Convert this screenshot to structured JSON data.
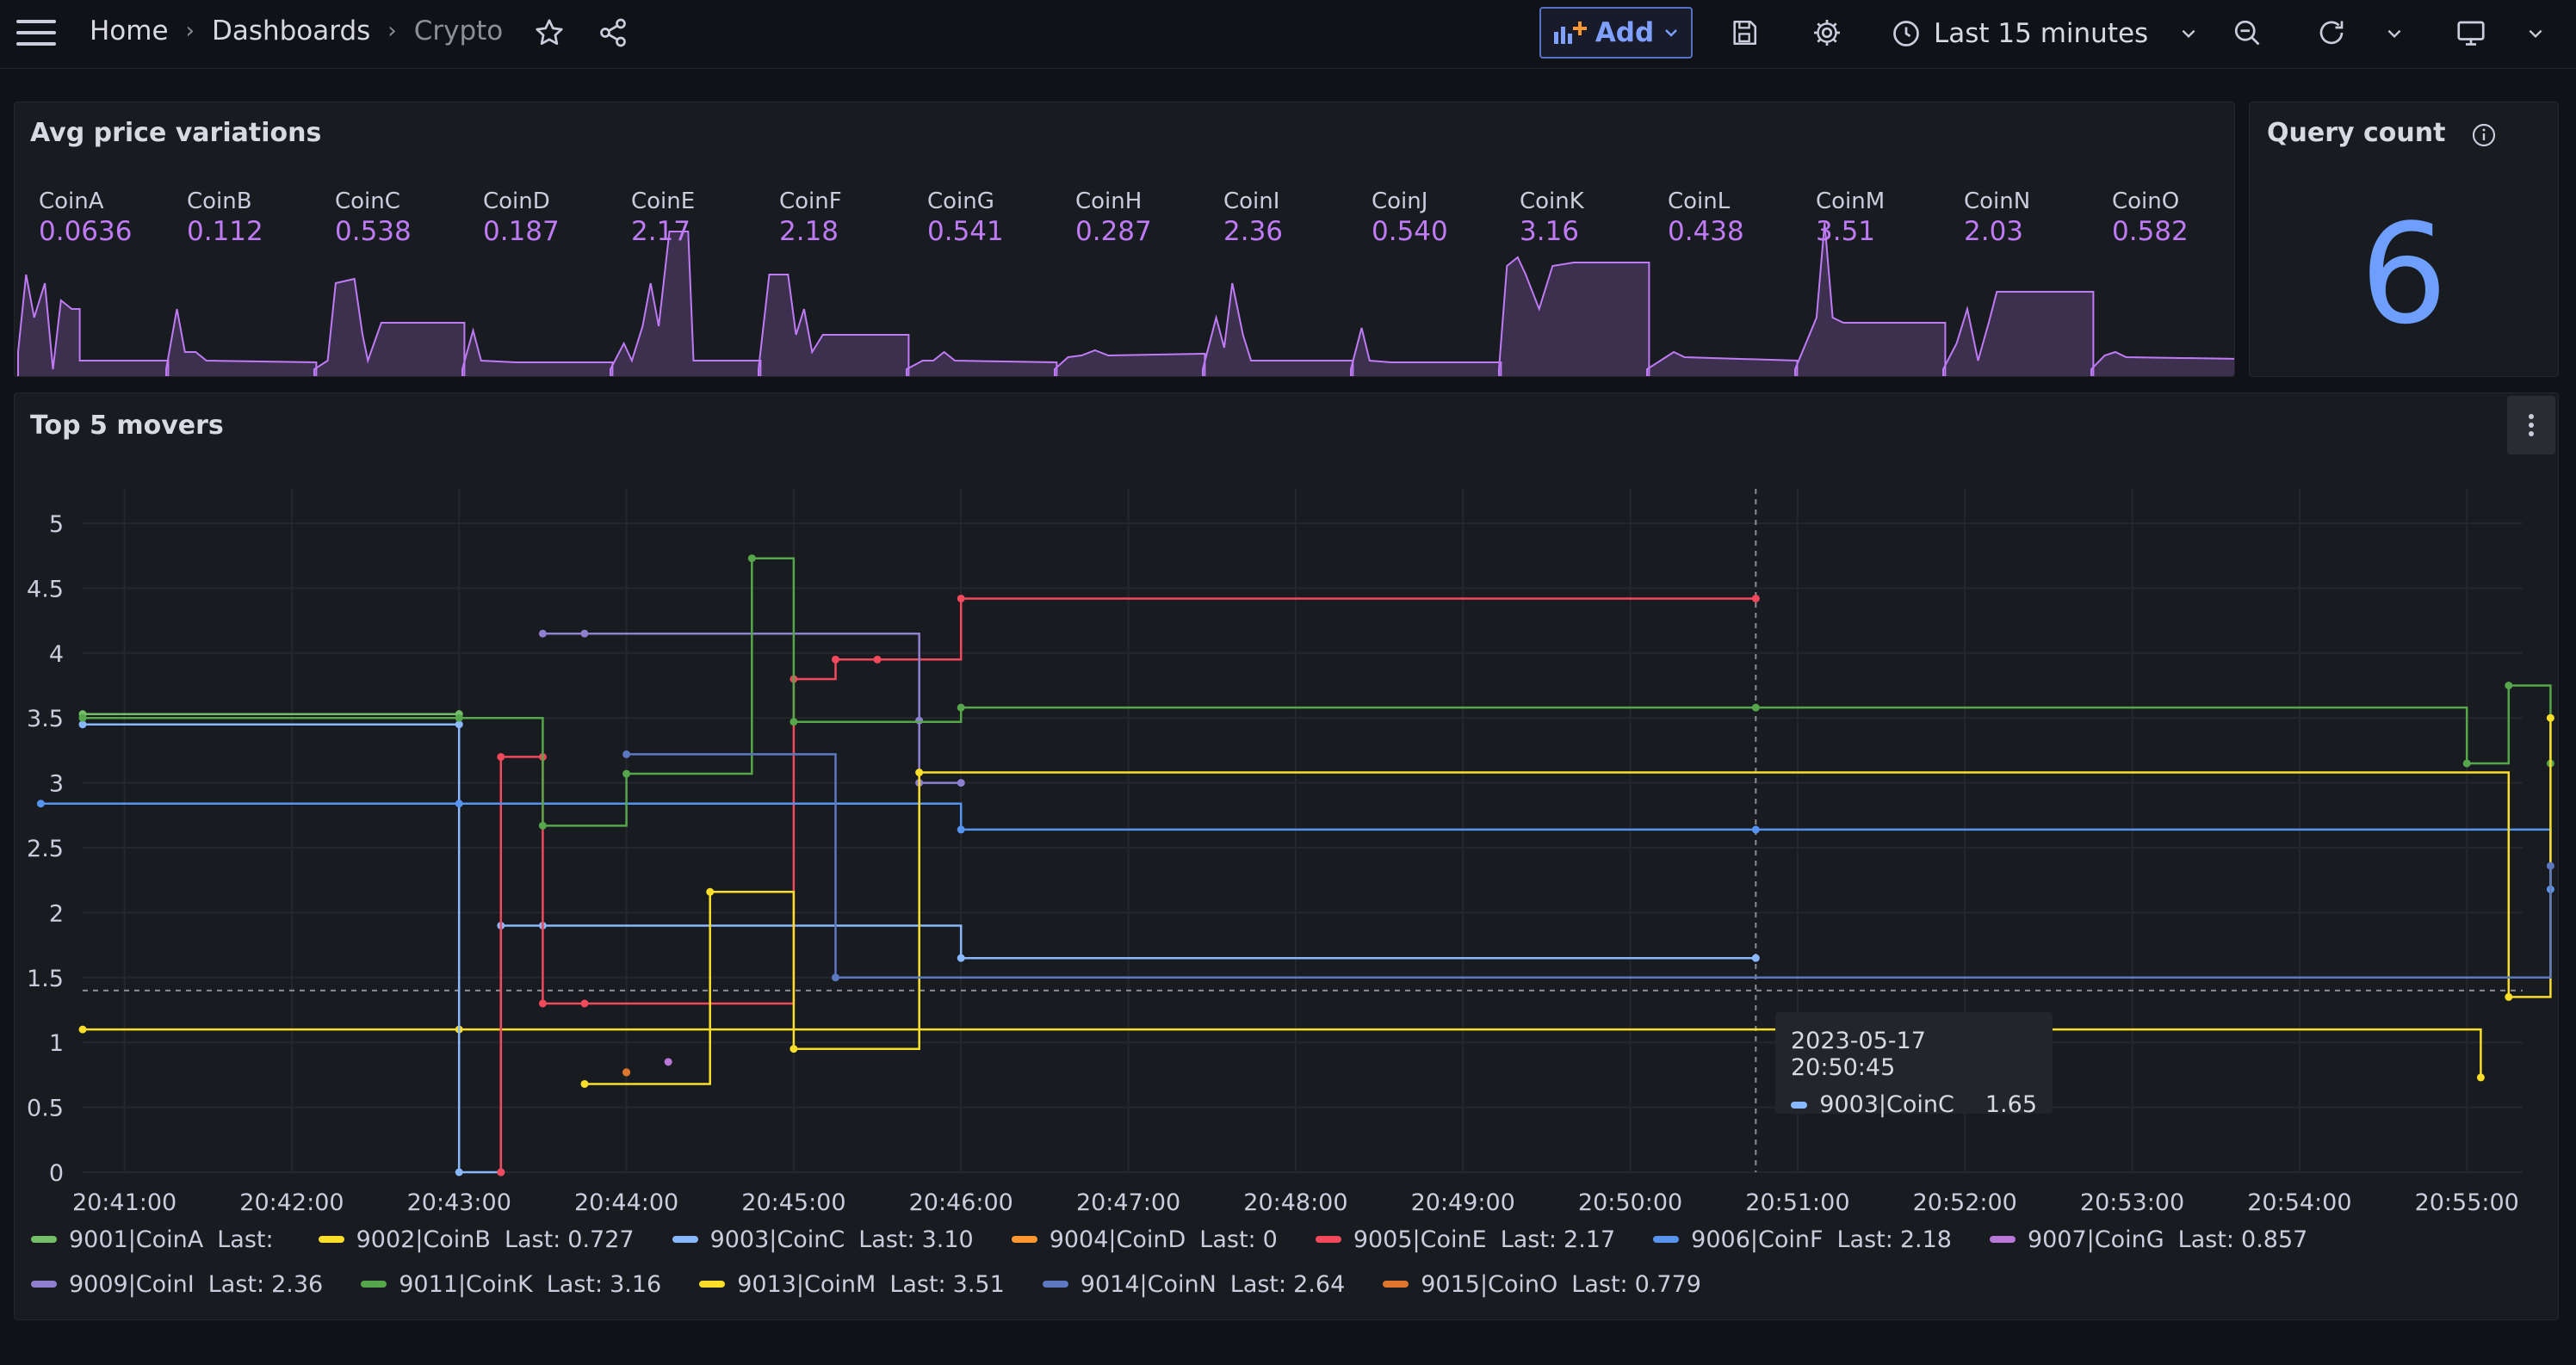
{
  "breadcrumbs": [
    "Home",
    "Dashboards",
    "Crypto"
  ],
  "toolbar": {
    "add_label": "Add",
    "time_range": "Last 15 minutes"
  },
  "avg_panel": {
    "title": "Avg price variations",
    "coins": [
      {
        "name": "CoinA",
        "value": "0.0636"
      },
      {
        "name": "CoinB",
        "value": "0.112"
      },
      {
        "name": "CoinC",
        "value": "0.538"
      },
      {
        "name": "CoinD",
        "value": "0.187"
      },
      {
        "name": "CoinE",
        "value": "2.17"
      },
      {
        "name": "CoinF",
        "value": "2.18"
      },
      {
        "name": "CoinG",
        "value": "0.541"
      },
      {
        "name": "CoinH",
        "value": "0.287"
      },
      {
        "name": "CoinI",
        "value": "2.36"
      },
      {
        "name": "CoinJ",
        "value": "0.540"
      },
      {
        "name": "CoinK",
        "value": "3.16"
      },
      {
        "name": "CoinL",
        "value": "0.438"
      },
      {
        "name": "CoinM",
        "value": "3.51"
      },
      {
        "name": "CoinN",
        "value": "2.03"
      },
      {
        "name": "CoinO",
        "value": "0.582"
      }
    ]
  },
  "query_panel": {
    "title": "Query count",
    "value": "6"
  },
  "movers_panel": {
    "title": "Top 5 movers",
    "tooltip": {
      "time": "2023-05-17 20:50:45",
      "series": "9003|CoinC",
      "value": "1.65"
    }
  },
  "chart_data": {
    "type": "line",
    "title": "Top 5 movers",
    "ylim": [
      0,
      5
    ],
    "yticks": [
      "0",
      "0.5",
      "1",
      "1.5",
      "2",
      "2.5",
      "3",
      "3.5",
      "4",
      "4.5",
      "5"
    ],
    "xticks": [
      "20:41:00",
      "20:42:00",
      "20:43:00",
      "20:44:00",
      "20:45:00",
      "20:46:00",
      "20:47:00",
      "20:48:00",
      "20:49:00",
      "20:50:00",
      "20:51:00",
      "20:52:00",
      "20:53:00",
      "20:54:00",
      "20:55:00"
    ],
    "grid": true,
    "legend": "bottom",
    "series": [
      {
        "name": "9001|CoinA",
        "color": "#73bf69",
        "last": "",
        "points": [
          [
            "20:40:45",
            3.53
          ],
          [
            "20:43:00",
            3.53
          ]
        ]
      },
      {
        "name": "9002|CoinB",
        "color": "#fade2a",
        "last": "0.727",
        "points": [
          [
            "20:40:45",
            1.1
          ],
          [
            "20:43:00",
            1.1
          ],
          [
            "20:55:05",
            0.73
          ]
        ]
      },
      {
        "name": "9003|CoinC",
        "color": "#8ab8ff",
        "last": "3.10",
        "points": [
          [
            "20:40:45",
            3.45
          ],
          [
            "20:43:00",
            3.45
          ],
          [
            "20:43:00",
            0
          ],
          [
            "20:43:15",
            0
          ],
          [
            "20:43:15",
            1.9
          ],
          [
            "20:43:30",
            1.9
          ],
          [
            "20:46:00",
            1.65
          ],
          [
            "20:50:45",
            1.65
          ]
        ]
      },
      {
        "name": "9004|CoinD",
        "color": "#ff9830",
        "last": "0",
        "points": [
          [
            "20:44:00",
            0.77
          ]
        ]
      },
      {
        "name": "9005|CoinE",
        "color": "#f2495c",
        "last": "2.17",
        "points": [
          [
            "20:43:15",
            0
          ],
          [
            "20:43:15",
            3.2
          ],
          [
            "20:43:30",
            3.2
          ],
          [
            "20:43:30",
            1.3
          ],
          [
            "20:43:45",
            1.3
          ],
          [
            "20:45:00",
            3.8
          ],
          [
            "20:45:15",
            3.95
          ],
          [
            "20:45:30",
            3.95
          ],
          [
            "20:46:00",
            4.42
          ],
          [
            "20:50:45",
            4.42
          ]
        ]
      },
      {
        "name": "9006|CoinF",
        "color": "#5794f2",
        "last": "2.18",
        "points": [
          [
            "20:40:30",
            2.84
          ],
          [
            "20:43:00",
            2.84
          ],
          [
            "20:46:00",
            2.64
          ],
          [
            "20:50:45",
            2.64
          ],
          [
            "20:55:30",
            2.18
          ]
        ]
      },
      {
        "name": "9007|CoinG",
        "color": "#b877d9",
        "last": "0.857",
        "points": [
          [
            "20:44:15",
            0.85
          ]
        ]
      },
      {
        "name": "9009|CoinI",
        "color": "#8f7fcf",
        "last": "2.36",
        "points": [
          [
            "20:43:30",
            4.15
          ],
          [
            "20:43:45",
            4.15
          ],
          [
            "20:45:45",
            3.48
          ],
          [
            "20:45:45",
            3.0
          ],
          [
            "20:46:00",
            3.0
          ]
        ]
      },
      {
        "name": "9011|CoinK",
        "color": "#56a64b",
        "last": "3.16",
        "points": [
          [
            "20:40:45",
            3.5
          ],
          [
            "20:43:00",
            3.5
          ],
          [
            "20:43:30",
            2.67
          ],
          [
            "20:44:00",
            3.07
          ],
          [
            "20:44:45",
            4.73
          ],
          [
            "20:45:00",
            3.47
          ],
          [
            "20:46:00",
            3.58
          ],
          [
            "20:50:45",
            3.58
          ],
          [
            "20:55:00",
            3.15
          ],
          [
            "20:55:15",
            3.75
          ],
          [
            "20:55:30",
            3.15
          ]
        ]
      },
      {
        "name": "9013|CoinM",
        "color": "#fade2a",
        "last": "3.51",
        "points": [
          [
            "20:43:45",
            0.68
          ],
          [
            "20:44:30",
            2.16
          ],
          [
            "20:45:00",
            0.95
          ],
          [
            "20:45:45",
            3.08
          ],
          [
            "20:55:15",
            1.35
          ],
          [
            "20:55:30",
            3.5
          ]
        ]
      },
      {
        "name": "9014|CoinN",
        "color": "#5b78c0",
        "last": "2.64",
        "points": [
          [
            "20:44:00",
            3.22
          ],
          [
            "20:45:15",
            1.5
          ],
          [
            "20:55:30",
            2.36
          ]
        ]
      },
      {
        "name": "9015|CoinO",
        "color": "#e0752d",
        "last": "0.779",
        "points": [
          [
            "20:44:00",
            0.77
          ]
        ]
      }
    ]
  }
}
